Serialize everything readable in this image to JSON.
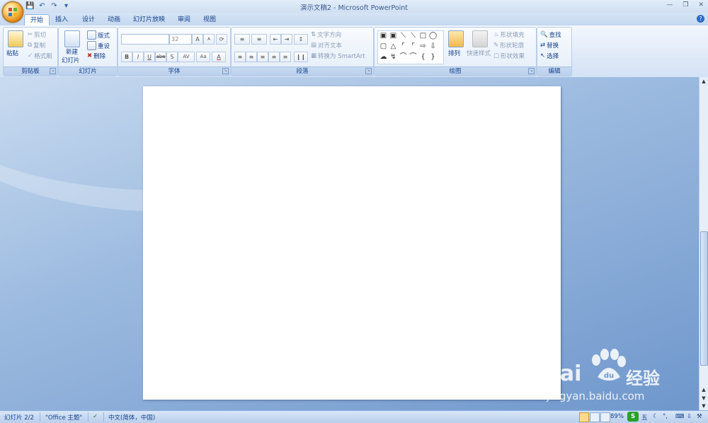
{
  "window": {
    "title": "演示文稿2 - Microsoft PowerPoint"
  },
  "tabs": [
    "开始",
    "插入",
    "设计",
    "动画",
    "幻灯片放映",
    "审阅",
    "视图"
  ],
  "ribbon": {
    "clipboard": {
      "label": "剪贴板",
      "paste": "粘贴",
      "cut": "剪切",
      "copy": "复制",
      "format_painter": "格式刷"
    },
    "slides": {
      "label": "幻灯片",
      "new_slide_1": "新建",
      "new_slide_2": "幻灯片",
      "layout": "版式",
      "reset": "重设",
      "delete": "删除"
    },
    "font": {
      "label": "字体",
      "size": "32",
      "bold": "B",
      "italic": "I",
      "underline": "U",
      "strike": "abe",
      "shadow": "S",
      "spacing": "AV",
      "case": "Aa",
      "color": "A",
      "grow": "A",
      "shrink": "A"
    },
    "paragraph": {
      "label": "段落",
      "text_direction": "文字方向",
      "align_text": "对齐文本",
      "smartart": "转换为 SmartArt"
    },
    "drawing": {
      "label": "绘图",
      "arrange": "排列",
      "quick_styles": "快速样式",
      "shape_fill": "形状填充",
      "shape_outline": "形状轮廓",
      "shape_effects": "形状效果"
    },
    "editing": {
      "label": "编辑",
      "find": "查找",
      "replace": "替换",
      "select": "选择"
    }
  },
  "statusbar": {
    "slide_counter": "幻灯片 2/2",
    "theme": "\"Office 主题\"",
    "language": "中文(简体，中国)",
    "zoom": "89%",
    "ime": "五"
  },
  "watermark": {
    "brand": "Bai",
    "brand2": "du",
    "cn": "经验",
    "url": "jingyan.baidu.com"
  },
  "icons": [
    "office-button-icon",
    "save-icon",
    "undo-icon",
    "redo-icon",
    "help-icon",
    "paste-icon",
    "cut-icon",
    "copy-icon",
    "format-painter-icon",
    "new-slide-icon",
    "layout-icon",
    "reset-icon",
    "delete-icon",
    "find-icon",
    "replace-icon",
    "select-icon",
    "arrange-icon",
    "quick-styles-icon",
    "spellcheck-icon",
    "normal-view-icon",
    "sorter-view-icon",
    "slideshow-view-icon"
  ]
}
